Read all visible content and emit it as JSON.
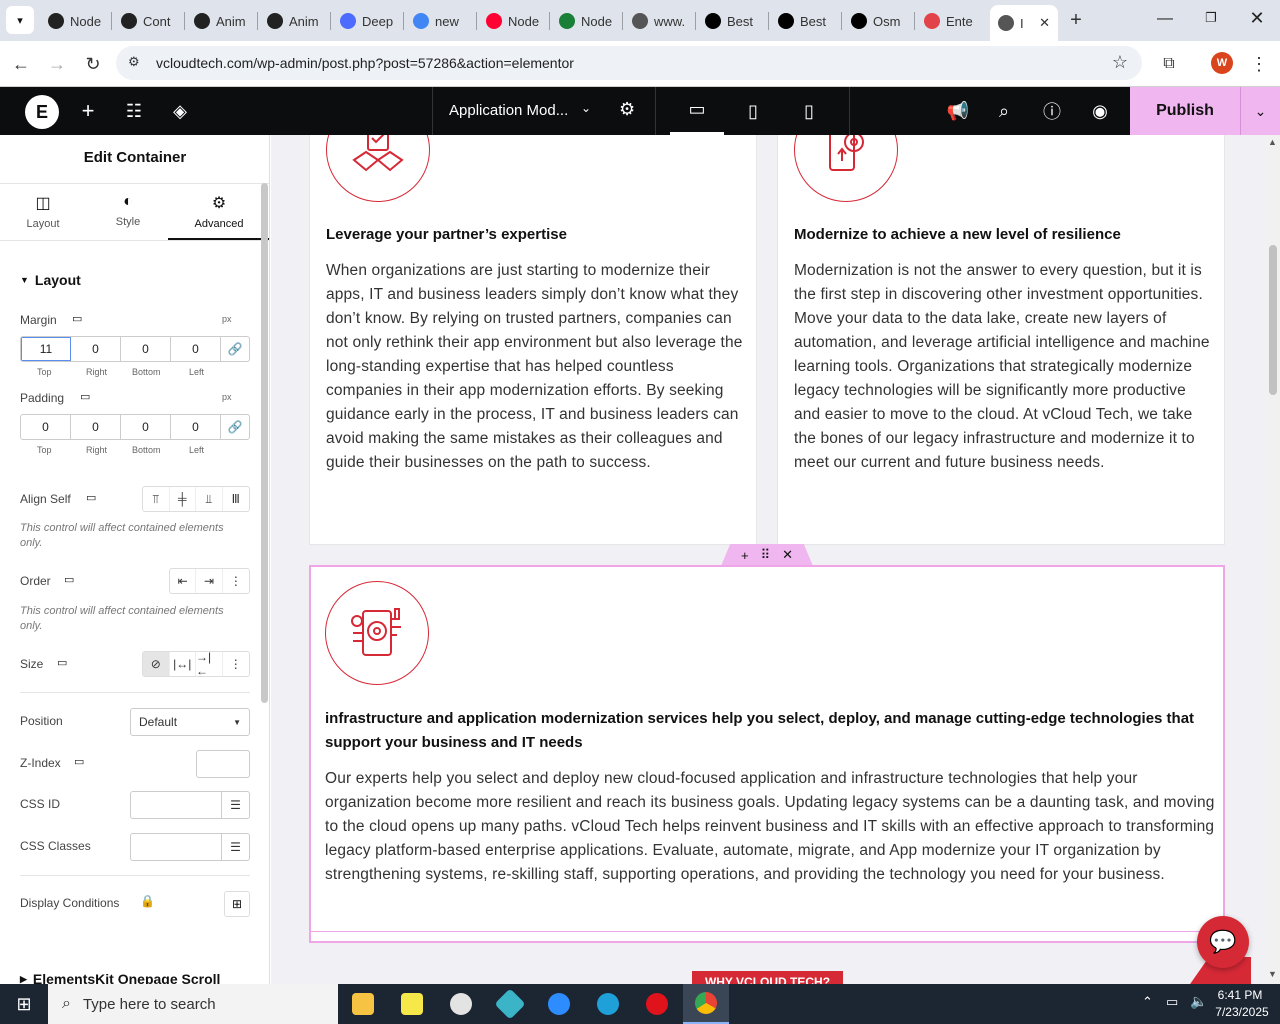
{
  "browser": {
    "tabs": [
      {
        "label": "Node",
        "icon": "chatgpt-icon",
        "color": "#222"
      },
      {
        "label": "Cont",
        "icon": "chatgpt-icon",
        "color": "#222"
      },
      {
        "label": "Anim",
        "icon": "chatgpt-icon",
        "color": "#222"
      },
      {
        "label": "Anim",
        "icon": "chatgpt-icon",
        "color": "#222"
      },
      {
        "label": "Deep",
        "icon": "deepseek-icon",
        "color": "#4d6bfe"
      },
      {
        "label": "new",
        "icon": "google-icon",
        "color": "#4285f4"
      },
      {
        "label": "Node",
        "icon": "youtube-icon",
        "color": "#ff0033"
      },
      {
        "label": "Node",
        "icon": "webflow-icon",
        "color": "#1a7f37"
      },
      {
        "label": "www.",
        "icon": "linkedin-icon",
        "color": "#555"
      },
      {
        "label": "Best",
        "icon": "x-icon",
        "color": "#000"
      },
      {
        "label": "Best",
        "icon": "x-icon",
        "color": "#000"
      },
      {
        "label": "Osm",
        "icon": "osmo-icon",
        "color": "#000"
      },
      {
        "label": "Ente",
        "icon": "elementor-diamond-icon",
        "color": "#e2434b"
      },
      {
        "label": "I",
        "icon": "wordpress-icon",
        "color": "#555",
        "active": true
      }
    ],
    "url": "vcloudtech.com/wp-admin/post.php?post=57286&action=elementor",
    "profile_initial": "W"
  },
  "topbar": {
    "page_name": "Application Mod...",
    "publish": "Publish"
  },
  "panel": {
    "title": "Edit Container",
    "tabs": [
      "Layout",
      "Style",
      "Advanced"
    ],
    "section": "Layout",
    "margin": {
      "label": "Margin",
      "unit": "px",
      "top": "11",
      "right": "0",
      "bottom": "0",
      "left": "0"
    },
    "padding": {
      "label": "Padding",
      "unit": "px",
      "top": "0",
      "right": "0",
      "bottom": "0",
      "left": "0"
    },
    "sides": [
      "Top",
      "Right",
      "Bottom",
      "Left"
    ],
    "align_self": "Align Self",
    "note": "This control will affect contained elements only.",
    "order": "Order",
    "size": "Size",
    "position": "Position",
    "position_value": "Default",
    "zindex": "Z-Index",
    "css_id": "CSS ID",
    "css_classes": "CSS Classes",
    "display_conditions": "Display Conditions",
    "next_section": "ElementsKit Onepage Scroll"
  },
  "content": {
    "card1": {
      "title": "Leverage your partner’s expertise",
      "text": "When organizations are just starting to modernize their apps, IT and business leaders simply don’t know what they don’t know. By relying on trusted partners, companies can not only rethink their app environment but also leverage the long-standing expertise that has helped countless companies in their app modernization efforts. By seeking guidance early in the process, IT and business leaders can avoid making the same mistakes as their colleagues and guide their businesses on the path to success."
    },
    "card2": {
      "title": "Modernize to achieve a new level of resilience",
      "text": "Modernization is not the answer to every question, but it is the first step in discovering other investment opportunities. Move your data to the data lake, create new layers of automation, and leverage artificial intelligence and machine learning tools. Organizations that strategically modernize legacy technologies will be significantly more productive and easier to move to the cloud. At vCloud Tech, we take the bones of our legacy infrastructure and modernize it to meet our current and future business needs."
    },
    "card3": {
      "title": "infrastructure and application modernization services help you select, deploy, and manage cutting-edge technologies that support your business and IT needs",
      "text": "Our experts help you select and deploy new cloud-focused application and infrastructure technologies that help your organization become more resilient and reach its business goals. Updating legacy systems can be a daunting task, and moving to the cloud opens up many paths. vCloud Tech helps reinvent business and IT skills with an effective approach to transforming legacy platform-based enterprise applications. Evaluate, automate, migrate, and App modernize your IT organization by strengthening systems, re-skilling staff, supporting operations, and providing the technology you need for your business."
    },
    "why_label": "WHY VCLOUD TECH?"
  },
  "taskbar": {
    "search_placeholder": "Type here to search",
    "time": "6:41 PM",
    "date": "7/23/2025"
  },
  "colors": {
    "accent": "#d62936",
    "elementor_pink": "#f0b6f0",
    "container_outline": "#f0a6e6"
  }
}
